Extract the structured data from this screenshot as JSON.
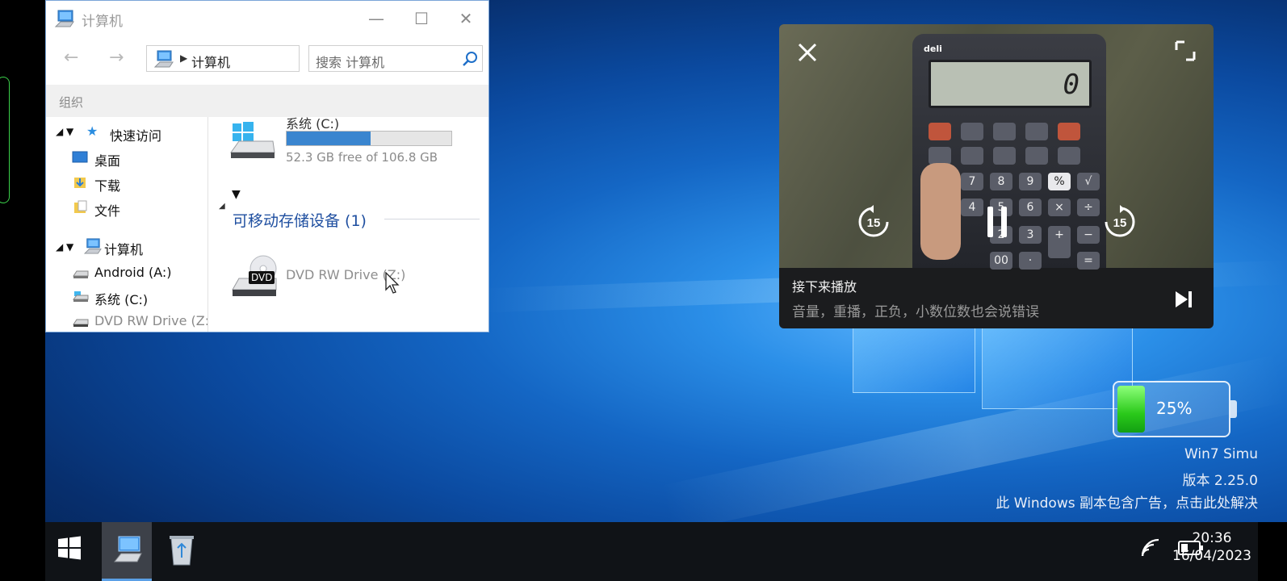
{
  "explorer": {
    "title": "计算机",
    "address_crumb": "计算机",
    "search_placeholder": "搜索 计算机",
    "ribbon_label": "组织",
    "nav": {
      "quick_access": "快速访问",
      "desktop": "桌面",
      "downloads": "下载",
      "documents": "文件",
      "computer": "计算机",
      "android": "Android (A:)",
      "system_c": "系统 (C:)",
      "dvd": "DVD RW Drive (Z:)"
    },
    "content": {
      "drive_c_name": "系统 (C:)",
      "drive_c_free": "52.3 GB free of 106.8 GB",
      "drive_c_used_fraction": 0.51,
      "removable_header": "可移动存储设备 (1)",
      "dvd_name": "DVD RW Drive (Z:)",
      "dvd_badge": "DVD"
    }
  },
  "video": {
    "skip_seconds": "15",
    "calc_display": "0",
    "next_label": "接下来播放",
    "next_title": "音量，重播，正负，小数位数也会说错误"
  },
  "battery": {
    "percent_label": "25%",
    "level": 0.25
  },
  "watermark": {
    "line1": "Win7 Simu",
    "line2": "版本 2.25.0",
    "line3": "此 Windows 副本包含广告，点击此处解决"
  },
  "taskbar": {
    "time": "20:36",
    "date": "16/04/2023"
  },
  "colors": {
    "accent": "#3a85cf",
    "battery_green": "#2ac91a",
    "taskbar": "#101317"
  }
}
